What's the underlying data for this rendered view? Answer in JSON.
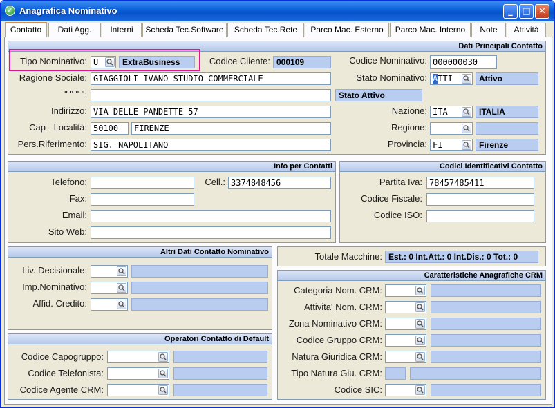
{
  "window": {
    "title": "Anagrafica Nominativo",
    "min_label": "_",
    "max_label": "□",
    "close_label": "✕"
  },
  "tabs": [
    "Contatto",
    "Dati Agg.",
    "Interni",
    "Scheda Tec.Software",
    "Scheda Tec.Rete",
    "Parco Mac. Esterno",
    "Parco Mac. Interno",
    "Note",
    "Attività"
  ],
  "principali": {
    "header": "Dati Principali Contatto",
    "tipo_label": "Tipo Nominativo:",
    "tipo_code": "U",
    "tipo_desc": "ExtraBusiness",
    "cliente_label": "Codice Cliente:",
    "cliente_value": "000109",
    "codnom_label": "Codice Nominativo:",
    "codnom_value": "000000030",
    "ragione_label": "Ragione Sociale:",
    "ragione_value": "GIAGGIOLI IVANO STUDIO COMMERCIALE",
    "stato_label": "Stato Nominativo:",
    "stato_code_sel": "A",
    "stato_code_rest": "TTI",
    "stato_desc": "Attivo",
    "ditto_label": "\"  \"  \"  \":",
    "ditto_value": "",
    "stato_attivo": "Stato Attivo",
    "indirizzo_label": "Indirizzo:",
    "indirizzo_value": "VIA DELLE PANDETTE 57",
    "nazione_label": "Nazione:",
    "nazione_code": "ITA",
    "nazione_desc": "ITALIA",
    "cap_label": "Cap - Località:",
    "cap_value": "50100",
    "citta_value": "FIRENZE",
    "regione_label": "Regione:",
    "regione_code": "",
    "regione_desc": "",
    "pers_label": "Pers.Riferimento:",
    "pers_value": "SIG. NAPOLITANO",
    "provincia_label": "Provincia:",
    "provincia_code": "FI",
    "provincia_desc": "Firenze"
  },
  "contatti": {
    "header": "Info per Contatti",
    "telefono_label": "Telefono:",
    "telefono_value": "",
    "cell_label": "Cell.:",
    "cell_value": "3374848456",
    "fax_label": "Fax:",
    "fax_value": "",
    "email_label": "Email:",
    "email_value": "",
    "sito_label": "Sito Web:",
    "sito_value": ""
  },
  "codici": {
    "header": "Codici Identificativi Contatto",
    "piva_label": "Partita Iva:",
    "piva_value": "78457485411",
    "cf_label": "Codice Fiscale:",
    "cf_value": "",
    "iso_label": "Codice ISO:",
    "iso_value": ""
  },
  "altri": {
    "header": "Altri Dati Contatto Nominativo",
    "liv_label": "Liv. Decisionale:",
    "imp_label": "Imp.Nominativo:",
    "affid_label": "Affid. Credito:"
  },
  "totale": {
    "label": "Totale Macchine:",
    "value": "Est.: 0 Int.Att.: 0 Int.Dis.: 0 Tot.: 0"
  },
  "crm": {
    "header": "Caratteristiche Anagrafiche CRM",
    "categoria_label": "Categoria Nom. CRM:",
    "attivita_label": "Attivita' Nom. CRM:",
    "zona_label": "Zona Nominativo CRM:",
    "gruppo_label": "Codice Gruppo CRM:",
    "natura_label": "Natura Giuridica CRM:",
    "tiponat_label": "Tipo Natura Giu. CRM:",
    "sic_label": "Codice SIC:"
  },
  "operatori": {
    "header": "Operatori Contatto di Default",
    "capogruppo_label": "Codice Capogruppo:",
    "telefonista_label": "Codice Telefonista:",
    "agente_label": "Codice Agente CRM:"
  }
}
